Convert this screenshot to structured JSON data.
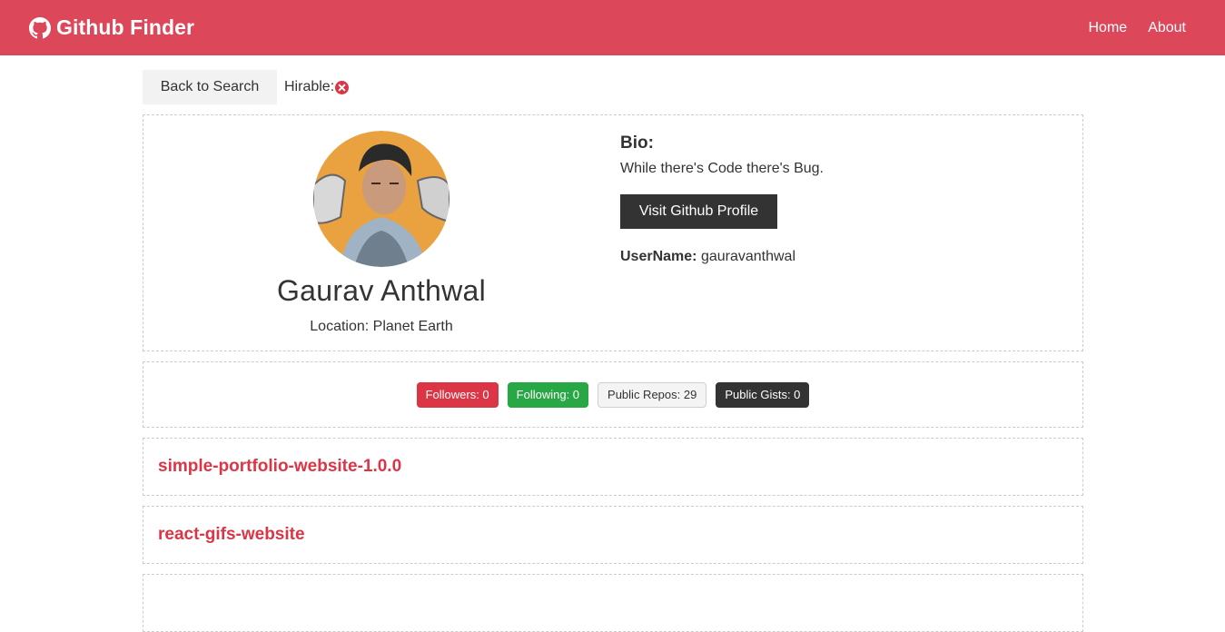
{
  "navbar": {
    "brand": "Github Finder",
    "links": [
      "Home",
      "About"
    ],
    "background": "#dc4759"
  },
  "top": {
    "back_label": "Back to Search",
    "hirable_label": "Hirable:",
    "hirable_icon": "x-circle-icon"
  },
  "profile": {
    "name": "Gaurav Anthwal",
    "location": "Location: Planet Earth",
    "bio_heading": "Bio:",
    "bio": "While there's Code there's Bug.",
    "visit_label": "Visit Github Profile",
    "username_label": "UserName:",
    "username": "gauravanthwal"
  },
  "stats": {
    "followers": "Followers: 0",
    "following": "Following: 0",
    "public_repos": "Public Repos: 29",
    "public_gists": "Public Gists: 0"
  },
  "repos": [
    {
      "name": "simple-portfolio-website-1.0.0"
    },
    {
      "name": "react-gifs-website"
    },
    {
      "name": ""
    }
  ],
  "colors": {
    "accent": "#dc3545",
    "success": "#28a745",
    "dark": "#333333"
  }
}
